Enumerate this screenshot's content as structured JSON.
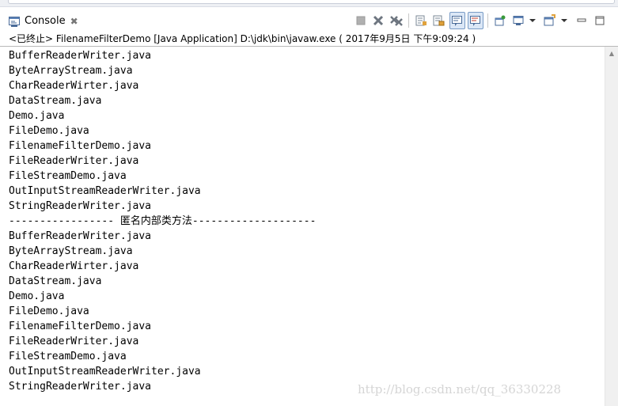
{
  "window": {
    "tab_label": "Console",
    "tab_close_glyph": "✖",
    "tab_icon": "console-icon"
  },
  "toolbar": {
    "buttons": [
      {
        "name": "terminate-button",
        "icon": "stop-square-icon"
      },
      {
        "name": "remove-launch-button",
        "icon": "remove-x-icon"
      },
      {
        "name": "remove-all-terminated-button",
        "icon": "remove-all-x-icon"
      },
      {
        "name": "clear-console-button",
        "icon": "clear-console-icon"
      },
      {
        "name": "scroll-lock-button",
        "icon": "scroll-lock-icon"
      },
      {
        "name": "show-when-stdout-button",
        "icon": "show-stdout-icon",
        "pressed": true
      },
      {
        "name": "show-when-stderr-button",
        "icon": "show-stderr-icon",
        "pressed": true
      },
      {
        "name": "pin-console-button",
        "icon": "pin-icon"
      },
      {
        "name": "display-selected-console-button",
        "icon": "monitor-icon"
      },
      {
        "name": "open-console-button",
        "icon": "new-console-icon"
      },
      {
        "name": "minimize-button",
        "icon": "minimize-icon"
      },
      {
        "name": "maximize-button",
        "icon": "maximize-icon"
      }
    ]
  },
  "status_line": "<已终止> FilenameFilterDemo [Java Application] D:\\jdk\\bin\\javaw.exe ( 2017年9月5日 下午9:09:24 )",
  "console_lines": [
    "BufferReaderWriter.java",
    "ByteArrayStream.java",
    "CharReaderWirter.java",
    "DataStream.java",
    "Demo.java",
    "FileDemo.java",
    "FilenameFilterDemo.java",
    "FileReaderWriter.java",
    "FileStreamDemo.java",
    "OutInputStreamReaderWriter.java",
    "StringReaderWriter.java",
    "----------------- 匿名内部类方法--------------------",
    "BufferReaderWriter.java",
    "ByteArrayStream.java",
    "CharReaderWirter.java",
    "DataStream.java",
    "Demo.java",
    "FileDemo.java",
    "FilenameFilterDemo.java",
    "FileReaderWriter.java",
    "FileStreamDemo.java",
    "OutInputStreamReaderWriter.java",
    "StringReaderWriter.java"
  ],
  "watermark": "http://blog.csdn.net/qq_36330228",
  "colors": {
    "pressed_bg": "#dbe7f6",
    "pressed_border": "#7a9cc6",
    "watermark": "#d5d5d5"
  }
}
